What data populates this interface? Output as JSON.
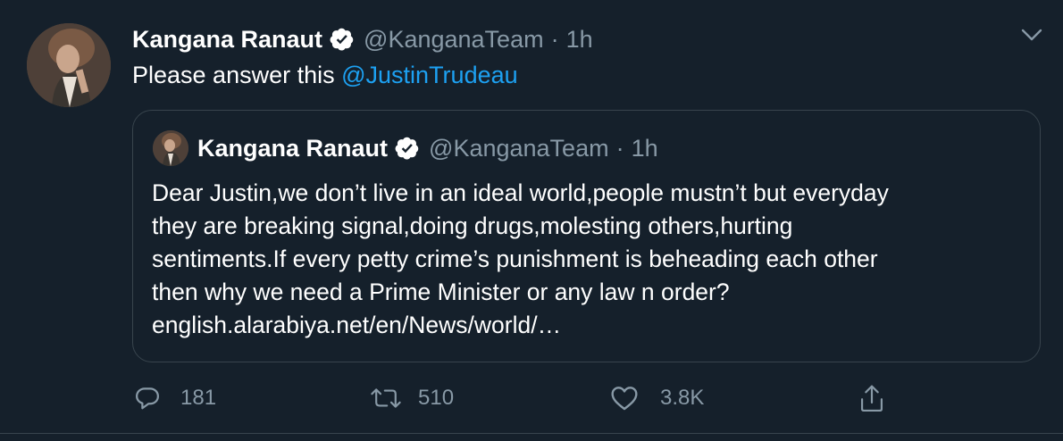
{
  "tweet": {
    "author_name": "Kangana Ranaut",
    "author_handle": "@KanganaTeam",
    "separator": "·",
    "time": "1h",
    "text_prefix": "Please answer this ",
    "mention": "@JustinTrudeau"
  },
  "quoted_tweet": {
    "author_name": "Kangana Ranaut",
    "author_handle": "@KanganaTeam",
    "separator": "·",
    "time": "1h",
    "text_lines": [
      "Dear Justin,we don’t live in an ideal world,people mustn’t but everyday",
      "they are breaking signal,doing drugs,molesting others,hurting",
      "sentiments.If every petty crime’s punishment is beheading each other",
      "then why we need a Prime Minister or any law n order?",
      "english.alarabiya.net/en/News/world/…"
    ]
  },
  "actions": {
    "reply_count": "181",
    "retweet_count": "510",
    "like_count": "3.8K"
  },
  "icons": {
    "verified": "verified-badge-icon",
    "more": "chevron-down-icon",
    "reply": "reply-icon",
    "retweet": "retweet-icon",
    "like": "heart-icon",
    "share": "share-icon"
  },
  "colors": {
    "background": "#15202b",
    "secondary_text": "#8899a6",
    "link": "#1da1f2",
    "border": "#38444d"
  }
}
